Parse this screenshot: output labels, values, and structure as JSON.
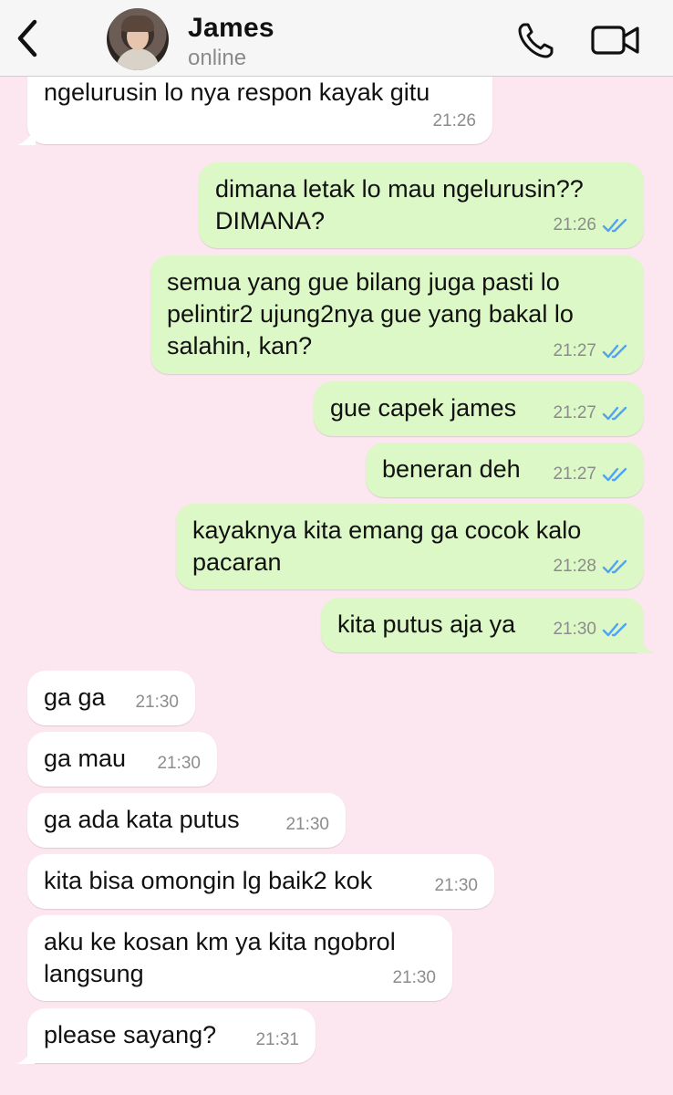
{
  "header": {
    "contact_name": "James",
    "status": "online",
    "back_icon": "chevron-left-icon",
    "call_icon": "phone-icon",
    "video_icon": "video-camera-icon"
  },
  "colors": {
    "background": "#fce6f0",
    "incoming_bubble": "#ffffff",
    "outgoing_bubble": "#dcf8c6",
    "read_tick": "#4fa3f7"
  },
  "messages": [
    {
      "dir": "in",
      "text": "ngelurusin lo nya respon kayak gitu",
      "time": "21:26"
    },
    {
      "dir": "out",
      "text": "dimana letak lo mau ngelurusin??\nDIMANA?",
      "time": "21:26",
      "read": true
    },
    {
      "dir": "out",
      "text": "semua yang gue bilang juga pasti lo\npelintir2 ujung2nya gue yang bakal lo\nsalahin, kan?",
      "time": "21:27",
      "read": true
    },
    {
      "dir": "out",
      "text": "gue capek james",
      "time": "21:27",
      "read": true
    },
    {
      "dir": "out",
      "text": "beneran deh",
      "time": "21:27",
      "read": true
    },
    {
      "dir": "out",
      "text": "kayaknya kita emang ga cocok kalo\npacaran",
      "time": "21:28",
      "read": true
    },
    {
      "dir": "out",
      "text": "kita putus aja ya",
      "time": "21:30",
      "read": true
    },
    {
      "dir": "in",
      "text": "ga ga",
      "time": "21:30"
    },
    {
      "dir": "in",
      "text": "ga mau",
      "time": "21:30"
    },
    {
      "dir": "in",
      "text": "ga ada kata putus",
      "time": "21:30"
    },
    {
      "dir": "in",
      "text": "kita bisa omongin lg baik2 kok",
      "time": "21:30"
    },
    {
      "dir": "in",
      "text": "aku ke kosan km ya kita ngobrol\nlangsung",
      "time": "21:30"
    },
    {
      "dir": "in",
      "text": "please sayang?",
      "time": "21:31"
    }
  ]
}
